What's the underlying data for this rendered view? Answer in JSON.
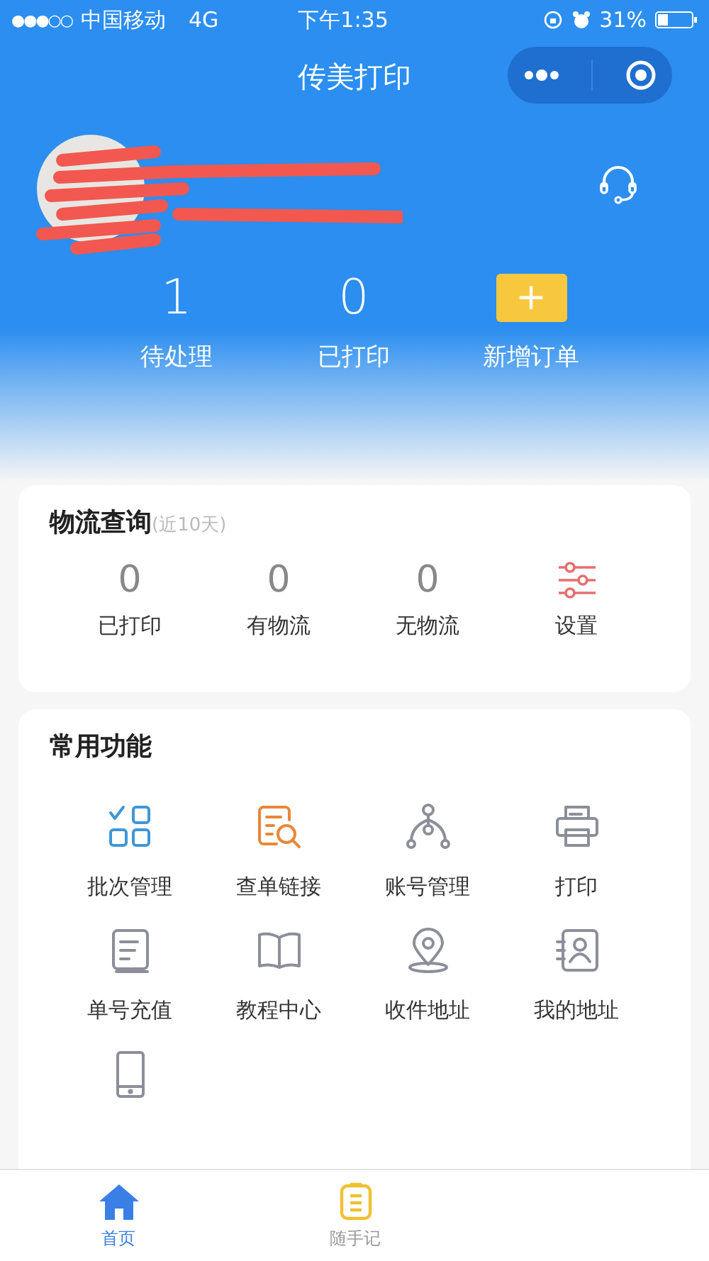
{
  "status_bar": {
    "signal": "●●●○○",
    "carrier": "中国移动",
    "network": "4G",
    "time": "下午1:35",
    "battery": "31%"
  },
  "nav": {
    "title": "传美打印"
  },
  "summary": [
    {
      "value": "1",
      "label": "待处理",
      "kind": "count"
    },
    {
      "value": "0",
      "label": "已打印",
      "kind": "count"
    },
    {
      "label": "新增订单",
      "kind": "add",
      "icon": "+"
    }
  ],
  "logistics": {
    "title": "物流查询",
    "note": "(近10天)",
    "items": [
      {
        "value": "0",
        "label": "已打印",
        "kind": "count"
      },
      {
        "value": "0",
        "label": "有物流",
        "kind": "count"
      },
      {
        "value": "0",
        "label": "无物流",
        "kind": "count"
      },
      {
        "label": "设置",
        "kind": "settings"
      }
    ]
  },
  "functions": {
    "title": "常用功能",
    "items": [
      {
        "label": "批次管理",
        "kind": "grid",
        "color": "#3e97d6"
      },
      {
        "label": "查单链接",
        "kind": "search-doc",
        "color": "#e8873a"
      },
      {
        "label": "账号管理",
        "kind": "tree",
        "color": "#8c8f99"
      },
      {
        "label": "打印",
        "kind": "printer",
        "color": "#8c8f99"
      },
      {
        "label": "单号充值",
        "kind": "doc",
        "color": "#8c8f99"
      },
      {
        "label": "教程中心",
        "kind": "book",
        "color": "#8c8f99"
      },
      {
        "label": "收件地址",
        "kind": "pin",
        "color": "#8c8f99"
      },
      {
        "label": "我的地址",
        "kind": "contact",
        "color": "#8c8f99"
      },
      {
        "kind": "phone",
        "color": "#8c8f99"
      }
    ]
  },
  "tab_bar": [
    {
      "label": "首页",
      "kind": "home",
      "selected": true
    },
    {
      "label": "随手记",
      "kind": "note",
      "selected": false
    }
  ]
}
